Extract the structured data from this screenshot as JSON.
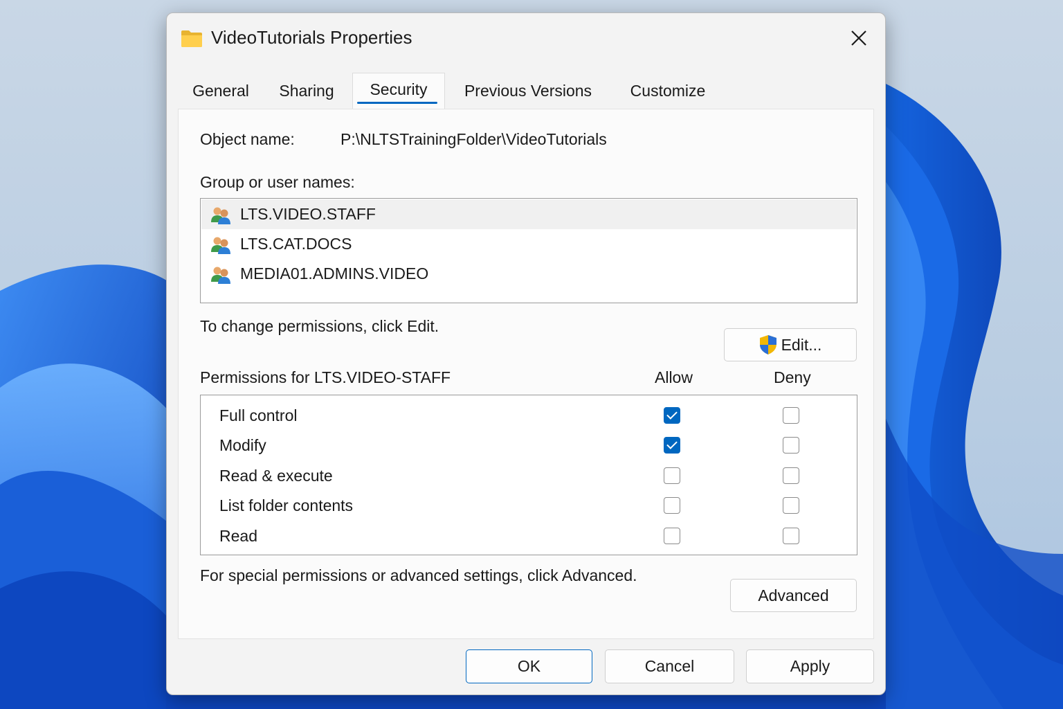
{
  "window": {
    "title": "VideoTutorials Properties"
  },
  "tabs": [
    {
      "label": "General",
      "active": false
    },
    {
      "label": "Sharing",
      "active": false
    },
    {
      "label": "Security",
      "active": true
    },
    {
      "label": "Previous Versions",
      "active": false
    },
    {
      "label": "Customize",
      "active": false
    }
  ],
  "security": {
    "object_name_label": "Object name:",
    "object_name_value": "P:\\NLTSTrainingFolder\\VideoTutorials",
    "group_label": "Group or user names:",
    "users": [
      {
        "name": "LTS.VIDEO.STAFF",
        "selected": true
      },
      {
        "name": "LTS.CAT.DOCS",
        "selected": false
      },
      {
        "name": "MEDIA01.ADMINS.VIDEO",
        "selected": false
      }
    ],
    "change_hint": "To change permissions, click Edit.",
    "edit_button": "Edit...",
    "permissions_label": "Permissions for LTS.VIDEO-STAFF",
    "allow_header": "Allow",
    "deny_header": "Deny",
    "permissions": [
      {
        "name": "Full control",
        "allow": true,
        "deny": false
      },
      {
        "name": "Modify",
        "allow": true,
        "deny": false
      },
      {
        "name": "Read & execute",
        "allow": false,
        "deny": false
      },
      {
        "name": "List folder contents",
        "allow": false,
        "deny": false
      },
      {
        "name": "Read",
        "allow": false,
        "deny": false
      }
    ],
    "advanced_hint": "For special permissions or advanced settings, click Advanced.",
    "advanced_button": "Advanced"
  },
  "footer": {
    "ok": "OK",
    "cancel": "Cancel",
    "apply": "Apply"
  },
  "colors": {
    "accent": "#0067c0",
    "wallpaper_blue": "#1e6fe0"
  },
  "icons": {
    "title": "folder-icon",
    "close": "close-icon",
    "user": "user-group-icon",
    "edit": "uac-shield-icon"
  }
}
